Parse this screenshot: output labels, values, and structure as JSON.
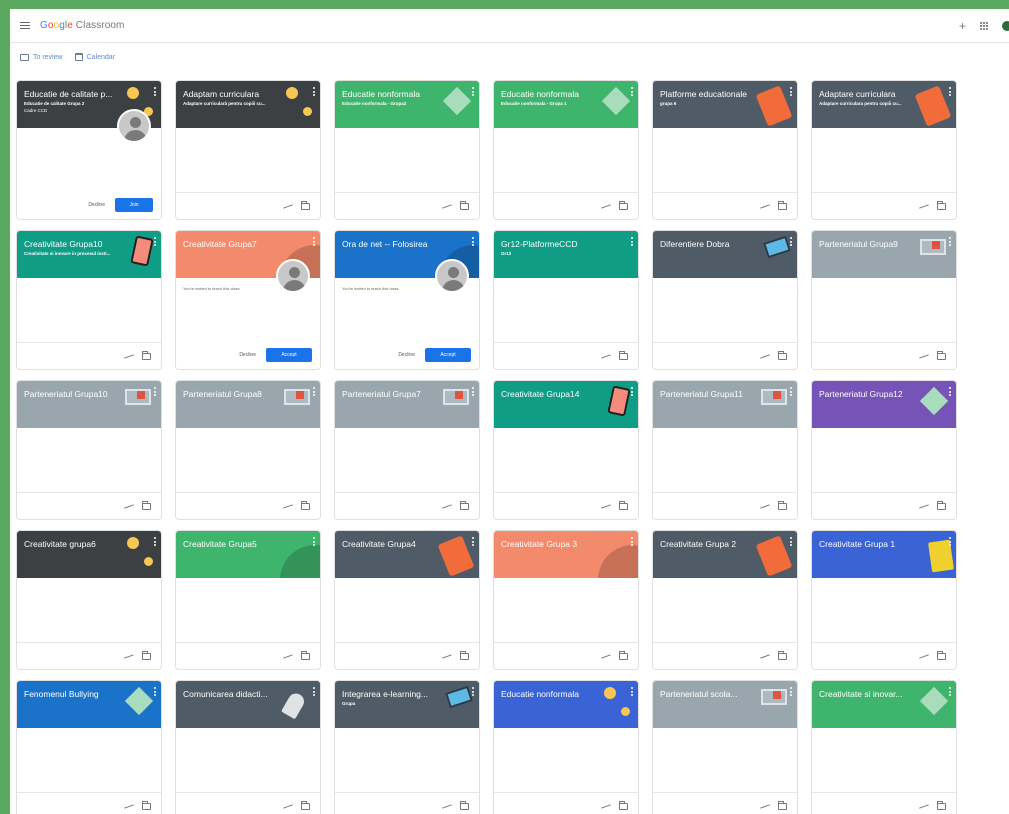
{
  "app": {
    "logo_parts": [
      "G",
      "o",
      "o",
      "g",
      "l",
      "e"
    ],
    "logo_product": "Classroom",
    "add_symbol": "+",
    "colors": {
      "accent": "#1a73e8",
      "frame": "#5aa95e"
    }
  },
  "subnav": {
    "todo_label": "To review",
    "calendar_label": "Calendar"
  },
  "cards": [
    {
      "title": "Educatie de calitate p...",
      "sub": "Educatie de calitate Grupa 2",
      "sub2": "Cadre CCD",
      "color": "#3c4043",
      "illus": "bulbs",
      "mode": "join",
      "decline": "Decline",
      "action": "Join"
    },
    {
      "title": "Adaptam curriculara",
      "sub": "Adaptare curriculară pentru copiii cu...",
      "sub2": "",
      "color": "#3c4043",
      "illus": "bulbs",
      "mode": "normal"
    },
    {
      "title": "Educatie nonformala",
      "sub": "Educatie nonformala - Grupa2",
      "sub2": "",
      "color": "#3fb46d",
      "illus": "diamond",
      "mode": "normal"
    },
    {
      "title": "Educatie nonformala",
      "sub": "Educatie nonformala - Grupa 1",
      "sub2": "",
      "color": "#3fb46d",
      "illus": "diamond",
      "mode": "normal"
    },
    {
      "title": "Platforme educationale",
      "sub": "grupa 6",
      "sub2": "",
      "color": "#4f5b66",
      "illus": "slab",
      "mode": "normal"
    },
    {
      "title": "Adaptare curriculara",
      "sub": "Adaptare curriculara pentru copiii cu...",
      "sub2": "",
      "color": "#4f5b66",
      "illus": "slab",
      "mode": "normal"
    },
    {
      "title": "Creativitate Grupa10",
      "sub": "Creativitate si inovare in procesul instr...",
      "sub2": "",
      "color": "#109d86",
      "illus": "tablet",
      "mode": "normal"
    },
    {
      "title": "Creativitate Grupa7",
      "sub": "",
      "sub2": "",
      "color": "#f28a6b",
      "illus": "curve",
      "mode": "accept",
      "body": "You're invited to teach this class",
      "decline": "Decline",
      "action": "Accept"
    },
    {
      "title": "Ora de net -- Folosirea",
      "sub": "",
      "sub2": "",
      "color": "#1a73c9",
      "illus": "curve",
      "mode": "accept",
      "body": "You're invited to teach this class",
      "decline": "Decline",
      "action": "Accept"
    },
    {
      "title": "Gr12-PlatformeCCD",
      "sub": "Gr12",
      "sub2": "",
      "color": "#109d86",
      "illus": "none",
      "mode": "normal"
    },
    {
      "title": "Diferentiere Dobra",
      "sub": "",
      "sub2": "",
      "color": "#4f5b66",
      "illus": "laptop",
      "mode": "normal"
    },
    {
      "title": "Parteneriatul Grupa9",
      "sub": "",
      "sub2": "",
      "color": "#9aa6ad",
      "illus": "board",
      "mode": "normal"
    },
    {
      "title": "Parteneriatul Grupa10",
      "sub": "",
      "sub2": "",
      "color": "#9aa6ad",
      "illus": "board",
      "mode": "normal"
    },
    {
      "title": "Parteneriatul Grupa8",
      "sub": "",
      "sub2": "",
      "color": "#9aa6ad",
      "illus": "board",
      "mode": "normal"
    },
    {
      "title": "Parteneriatul Grupa7",
      "sub": "",
      "sub2": "",
      "color": "#9aa6ad",
      "illus": "board",
      "mode": "normal"
    },
    {
      "title": "Creativitate Grupa14",
      "sub": "",
      "sub2": "",
      "color": "#109d86",
      "illus": "tablet",
      "mode": "normal"
    },
    {
      "title": "Parteneriatul Grupa11",
      "sub": "",
      "sub2": "",
      "color": "#9aa6ad",
      "illus": "board",
      "mode": "normal"
    },
    {
      "title": "Parteneriatul Grupa12",
      "sub": "",
      "sub2": "",
      "color": "#7653b6",
      "illus": "diamond",
      "mode": "normal"
    },
    {
      "title": "Creativitate grupa6",
      "sub": "",
      "sub2": "",
      "color": "#3c4043",
      "illus": "bulbs",
      "mode": "normal"
    },
    {
      "title": "Creativitate Grupa5",
      "sub": "",
      "sub2": "",
      "color": "#3fb46d",
      "illus": "curve",
      "mode": "normal"
    },
    {
      "title": "Creativitate Grupa4",
      "sub": "",
      "sub2": "",
      "color": "#4f5b66",
      "illus": "slab",
      "mode": "normal"
    },
    {
      "title": "Creativitate Grupa 3",
      "sub": "",
      "sub2": "",
      "color": "#f28a6b",
      "illus": "curve",
      "mode": "normal"
    },
    {
      "title": "Creativitate Grupa 2",
      "sub": "",
      "sub2": "",
      "color": "#4f5b66",
      "illus": "slab",
      "mode": "normal"
    },
    {
      "title": "Creativitate Grupa 1",
      "sub": "",
      "sub2": "",
      "color": "#3a63d6",
      "illus": "notebook",
      "mode": "normal"
    },
    {
      "title": "Fenomenul Bullying",
      "sub": "",
      "sub2": "",
      "color": "#1a73c9",
      "illus": "diamond",
      "mode": "normal"
    },
    {
      "title": "Comunicarea didacti...",
      "sub": "",
      "sub2": "",
      "color": "#4f5b66",
      "illus": "rocket",
      "mode": "normal"
    },
    {
      "title": "Integrarea e-learning...",
      "sub": "Grupa",
      "sub2": "",
      "color": "#4f5b66",
      "illus": "laptop",
      "mode": "normal"
    },
    {
      "title": "Educatie nonformala",
      "sub": "",
      "sub2": "",
      "color": "#3a63d6",
      "illus": "bulbs",
      "mode": "normal"
    },
    {
      "title": "Parteneriatul scola...",
      "sub": "",
      "sub2": "",
      "color": "#9aa6ad",
      "illus": "board",
      "mode": "normal"
    },
    {
      "title": "Creativitate si inovar...",
      "sub": "",
      "sub2": "",
      "color": "#3fb46d",
      "illus": "diamond",
      "mode": "normal"
    }
  ]
}
